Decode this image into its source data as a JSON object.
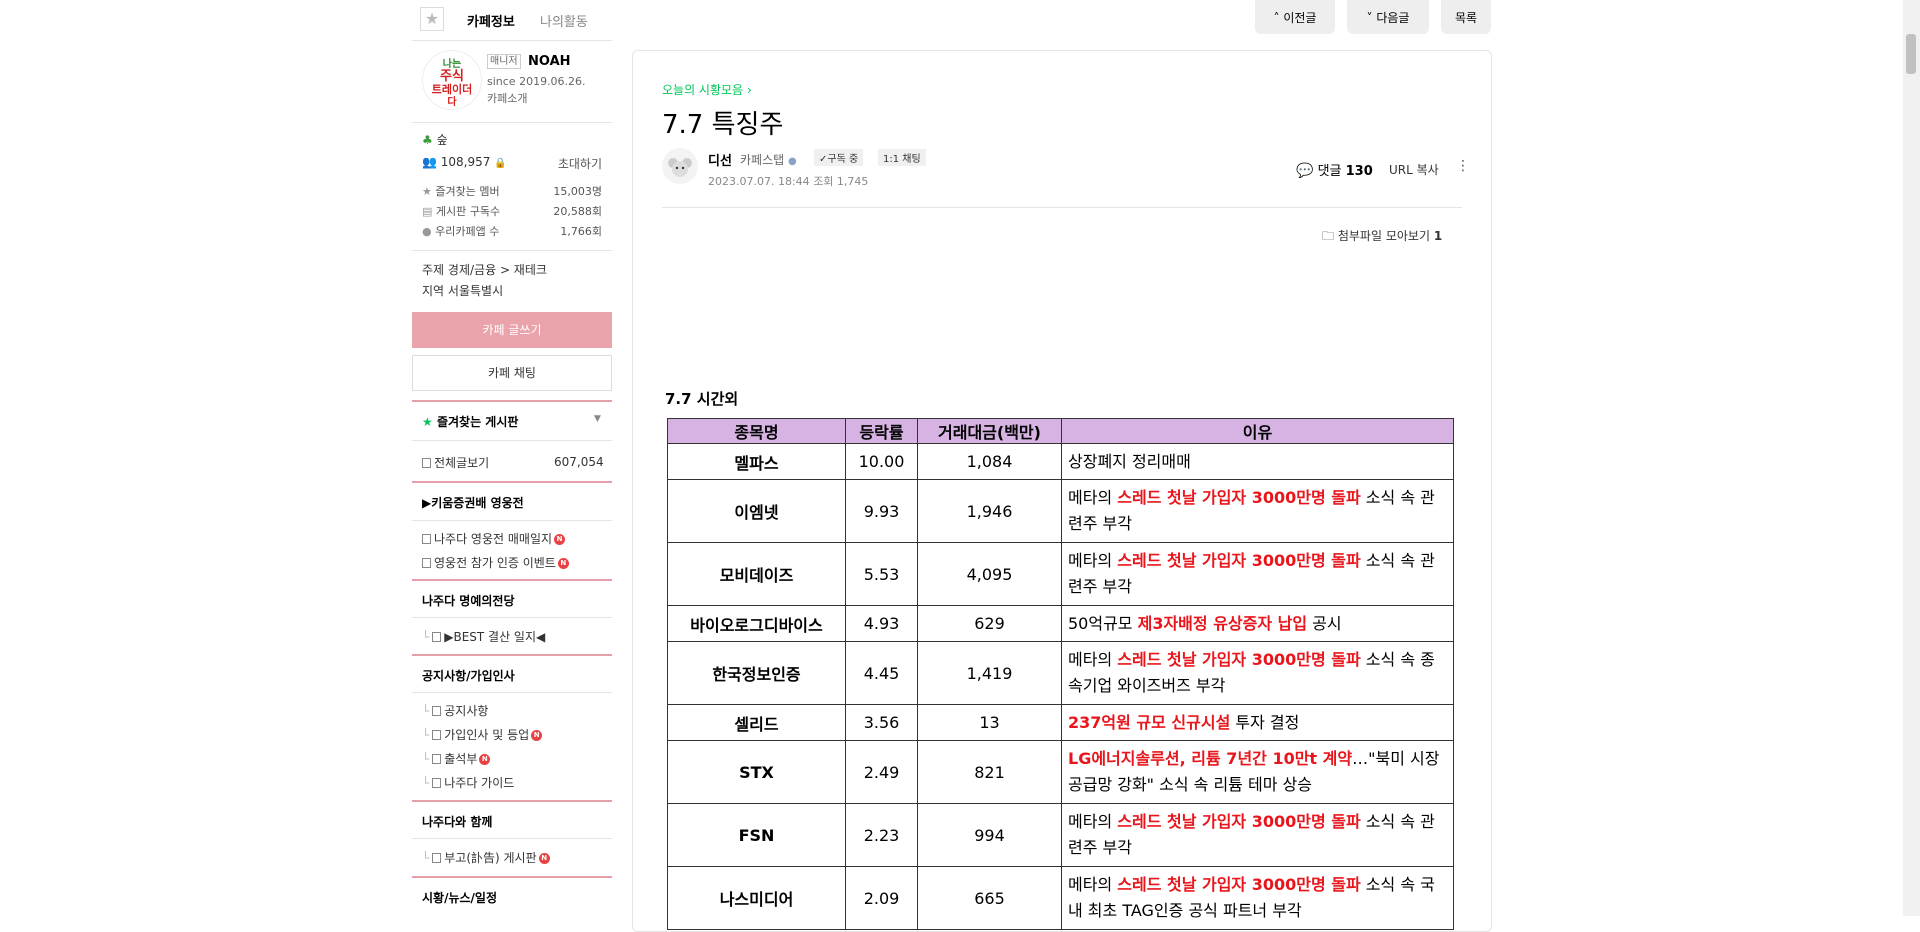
{
  "sidebar": {
    "tab_cafe_info": "카페정보",
    "tab_my_activity": "나의활동",
    "manager_badge": "매니저",
    "manager_name": "NOAH",
    "since": "since 2019.06.26.",
    "cafe_intro": "카페소개",
    "grade": "숲",
    "member_count": "108,957",
    "invite": "초대하기",
    "stats": [
      {
        "label": "즐겨찾는 멤버",
        "value": "15,003명"
      },
      {
        "label": "게시판 구독수",
        "value": "20,588회"
      },
      {
        "label": "우리카페앱 수",
        "value": "1,766회"
      }
    ],
    "topic_label": "주제",
    "topic_value": "경제/금융 > 재테크",
    "region_label": "지역",
    "region_value": "서울특별시",
    "write_button": "카페 글쓰기",
    "chat_button": "카페 채팅",
    "favorites": "즐겨찾는 게시판",
    "all_posts": "전체글보기",
    "all_posts_count": "607,054",
    "section1": "▶키움증권배 영웅전",
    "section1_items": [
      "나주다 영웅전 매매일지",
      "영웅전 참가 인증 이벤트"
    ],
    "section2": "나주다 명예의전당",
    "section2_items": [
      "▶BEST 결산 일지◀"
    ],
    "section3": "공지사항/가입인사",
    "section3_items": [
      "공지사항",
      "가입인사 및 등업",
      "출석부",
      "나주다 가이드"
    ],
    "section4": "나주다와 함께",
    "section4_items": [
      "부고(訃告) 게시판"
    ],
    "section5": "시황/뉴스/일정",
    "new_badge": "N"
  },
  "topnav": {
    "prev": "이전글",
    "next": "다음글",
    "list": "목록"
  },
  "article": {
    "board": "오늘의 시황모음",
    "title": "7.7 특징주",
    "author": "디선",
    "author_grade": "카페스탭",
    "subscribe": "✓구독 중",
    "chat": "1:1 채팅",
    "date": "2023.07.07. 18:44",
    "views": "조회 1,745",
    "comments_label": "댓글",
    "comments_count": "130",
    "url_copy": "URL 복사",
    "attach_label": "첨부파일 모아보기",
    "attach_count": "1",
    "section_title": "7.7 시간외"
  },
  "table": {
    "headers": [
      "종목명",
      "등락률",
      "거래대금(백만)",
      "이유"
    ],
    "rows": [
      {
        "name": "멜파스",
        "rate": "10.00",
        "amount": "1,084",
        "pre": "상장폐지 정리매매",
        "red": "",
        "post": ""
      },
      {
        "name": "이엠넷",
        "rate": "9.93",
        "amount": "1,946",
        "pre": "메타의 ",
        "red": "스레드 첫날 가입자 3000만명 돌파",
        "post": " 소식 속 관련주 부각"
      },
      {
        "name": "모비데이즈",
        "rate": "5.53",
        "amount": "4,095",
        "pre": "메타의 ",
        "red": "스레드 첫날 가입자 3000만명 돌파",
        "post": " 소식 속 관련주 부각"
      },
      {
        "name": "바이오로그디바이스",
        "rate": "4.93",
        "amount": "629",
        "pre": "50억규모 ",
        "red": "제3자배정 유상증자 납입",
        "post": " 공시"
      },
      {
        "name": "한국정보인증",
        "rate": "4.45",
        "amount": "1,419",
        "pre": "메타의 ",
        "red": "스레드 첫날 가입자 3000만명 돌파",
        "post": " 소식 속 종속기업 와이즈버즈 부각"
      },
      {
        "name": "셀리드",
        "rate": "3.56",
        "amount": "13",
        "pre": "",
        "red": "237억원 규모 신규시설",
        "post": " 투자 결정"
      },
      {
        "name": "STX",
        "rate": "2.49",
        "amount": "821",
        "pre": "",
        "red": "LG에너지솔루션, 리튬 7년간 10만t 계약",
        "post": "…\"북미 시장 공급망 강화\" 소식 속 리튬 테마 상승"
      },
      {
        "name": "FSN",
        "rate": "2.23",
        "amount": "994",
        "pre": "메타의 ",
        "red": "스레드 첫날 가입자 3000만명 돌파",
        "post": " 소식 속 관련주 부각"
      },
      {
        "name": "나스미디어",
        "rate": "2.09",
        "amount": "665",
        "pre": "메타의 ",
        "red": "스레드 첫날 가입자 3000만명 돌파",
        "post": " 소식 속 국내 최초 TAG인증 공식 파트너 부각"
      }
    ]
  },
  "colors": {
    "accent_green": "#03c75a",
    "write_button": "#eba3ab",
    "section_line": "#e8a0a8",
    "table_header": "#d6b3e3",
    "highlight_red": "#e8161c"
  }
}
